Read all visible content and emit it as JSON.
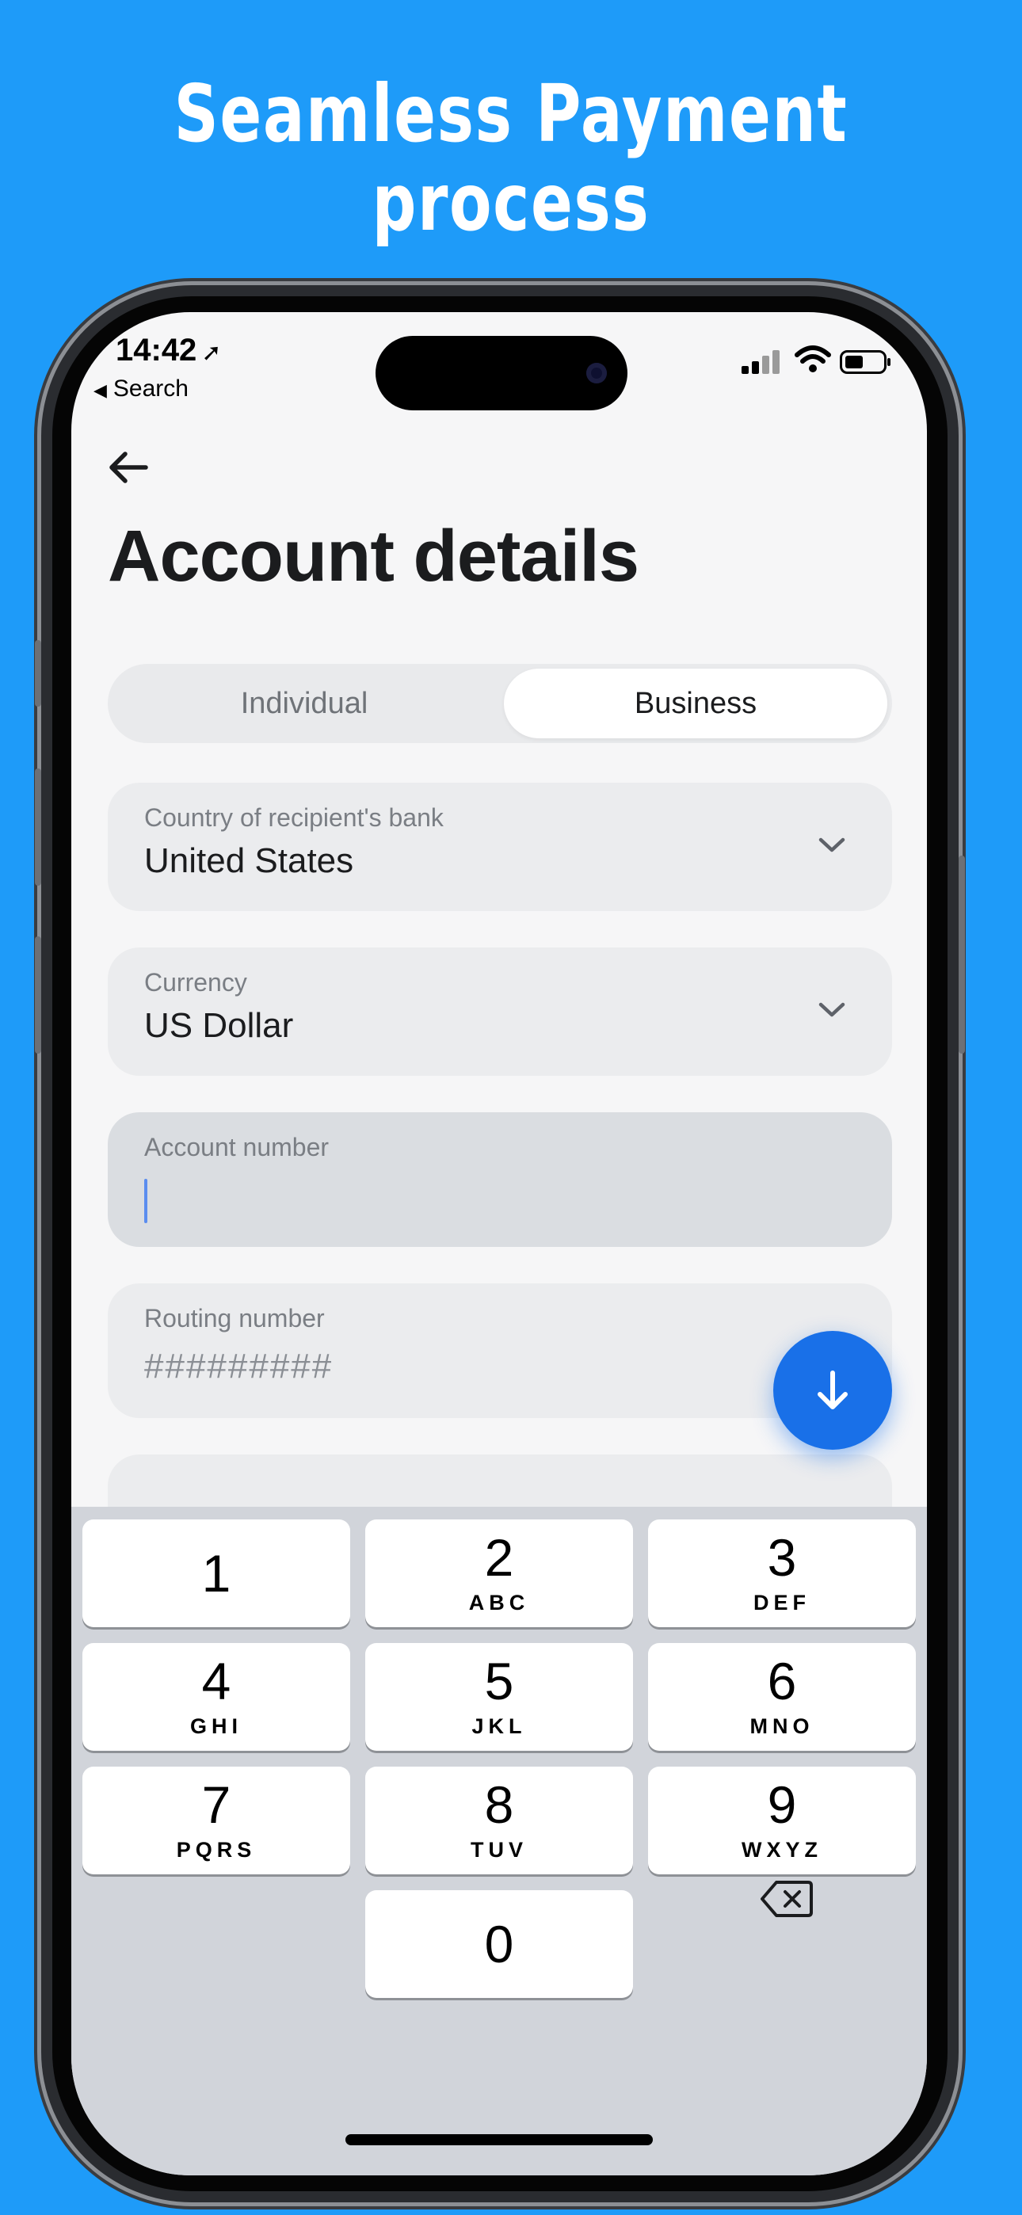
{
  "headline": {
    "line1": "Seamless Payment",
    "line2": "process"
  },
  "status_bar": {
    "time": "14:42",
    "back_app": "Search"
  },
  "page": {
    "title": "Account details"
  },
  "segment": {
    "options": [
      "Individual",
      "Business"
    ],
    "selected": "Business"
  },
  "fields": {
    "country": {
      "label": "Country of recipient's bank",
      "value": "United States"
    },
    "currency": {
      "label": "Currency",
      "value": "US Dollar"
    },
    "account": {
      "label": "Account number",
      "value": ""
    },
    "routing": {
      "label": "Routing number",
      "placeholder": "#########"
    }
  },
  "keypad": {
    "keys": [
      {
        "num": "1",
        "letters": ""
      },
      {
        "num": "2",
        "letters": "ABC"
      },
      {
        "num": "3",
        "letters": "DEF"
      },
      {
        "num": "4",
        "letters": "GHI"
      },
      {
        "num": "5",
        "letters": "JKL"
      },
      {
        "num": "6",
        "letters": "MNO"
      },
      {
        "num": "7",
        "letters": "PQRS"
      },
      {
        "num": "8",
        "letters": "TUV"
      },
      {
        "num": "9",
        "letters": "WXYZ"
      },
      {
        "num": "0",
        "letters": ""
      }
    ]
  },
  "colors": {
    "background": "#1E9BF9",
    "accent": "#1970E8",
    "caret": "#5B8DEF"
  },
  "icons": [
    "back-arrow-icon",
    "chevron-down-icon",
    "arrow-down-icon",
    "backspace-icon",
    "signal-icon",
    "wifi-icon",
    "battery-icon",
    "location-arrow-icon"
  ]
}
